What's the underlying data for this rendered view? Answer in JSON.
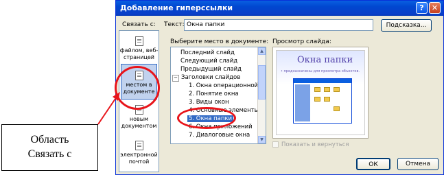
{
  "window": {
    "title": "Добавление гиперссылки",
    "help_glyph": "?",
    "close_glyph": "✕"
  },
  "link_to": {
    "label": "Связать с:",
    "items": [
      {
        "label": "файлом, веб-страницей",
        "icon": "web-page-icon",
        "selected": false
      },
      {
        "label": "местом в документе",
        "icon": "document-place-icon",
        "selected": true
      },
      {
        "label": "новым документом",
        "icon": "new-document-icon",
        "selected": false
      },
      {
        "label": "электронной почтой",
        "icon": "email-icon",
        "selected": false
      }
    ]
  },
  "text_field": {
    "label": "Текст:",
    "value": "Окна папки"
  },
  "tip_button": "Подсказка...",
  "place_label": "Выберите место в документе:",
  "tree": [
    {
      "label": "Последний слайд",
      "indent": 0,
      "selected": false
    },
    {
      "label": "Следующий слайд",
      "indent": 0,
      "selected": false
    },
    {
      "label": "Предыдущий слайд",
      "indent": 0,
      "selected": false
    },
    {
      "label": "Заголовки слайдов",
      "indent": 0,
      "expander": "−",
      "selected": false
    },
    {
      "label": "1. Окна операционной сис",
      "indent": 1,
      "selected": false
    },
    {
      "label": "2. Понятие окна",
      "indent": 1,
      "selected": false
    },
    {
      "label": "3. Виды окон",
      "indent": 1,
      "selected": false
    },
    {
      "label": "4. Основные элементы ок",
      "indent": 1,
      "selected": false
    },
    {
      "label": "5. Окна папки",
      "indent": 1,
      "selected": true
    },
    {
      "label": "6. Окна приложений",
      "indent": 1,
      "selected": false
    },
    {
      "label": "7. Диалоговые окна",
      "indent": 1,
      "selected": false
    }
  ],
  "preview": {
    "label": "Просмотр слайда:",
    "slide_title": "Окна папки",
    "slide_bullet": "• предназначены для просмотра объектов."
  },
  "show_and_return": "Показать и вернуться",
  "ok_button": "ОК",
  "cancel_button": "Отмена",
  "callout": {
    "line1": "Область",
    "line2": "Связать с"
  },
  "colors": {
    "annotation_red": "#e8141a",
    "title_bar": "#0a5fe0",
    "selection": "#316ac5"
  }
}
